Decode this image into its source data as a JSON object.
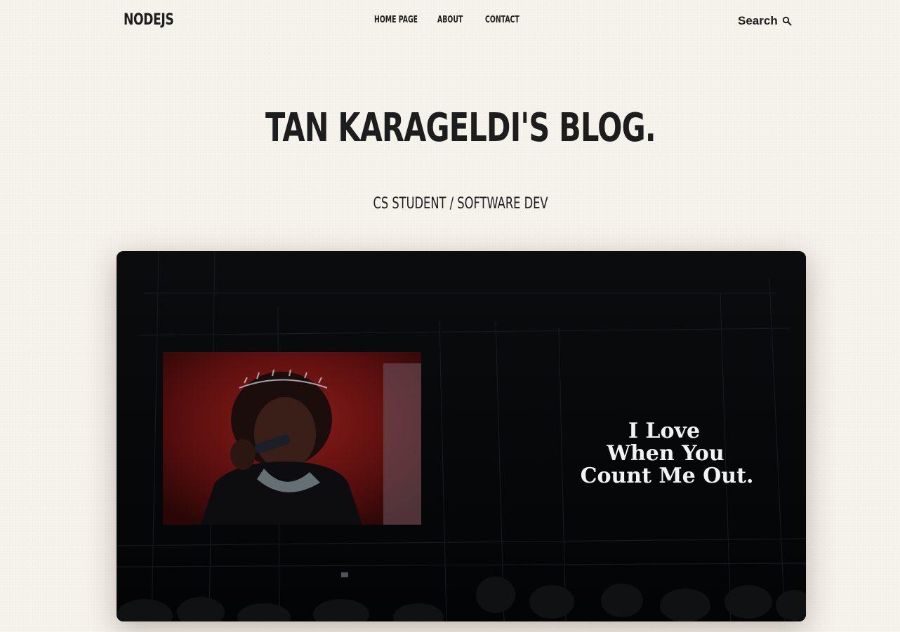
{
  "nav": {
    "logo": "NODEJS",
    "links": [
      {
        "label": "HOME PAGE"
      },
      {
        "label": "ABOUT"
      },
      {
        "label": "CONTACT"
      }
    ],
    "search_label": "Search",
    "search_icon": "search-icon"
  },
  "hero": {
    "title": "TAN KARAGELDI'S BLOG.",
    "subtitle": "CS STUDENT / SOFTWARE DEV",
    "image": {
      "screen_text": [
        "I Love",
        "When You",
        "Count Me Out."
      ]
    }
  },
  "colors": {
    "background": "#f6f2ec",
    "text": "#1d1d1d",
    "image_bg": "#050607"
  }
}
